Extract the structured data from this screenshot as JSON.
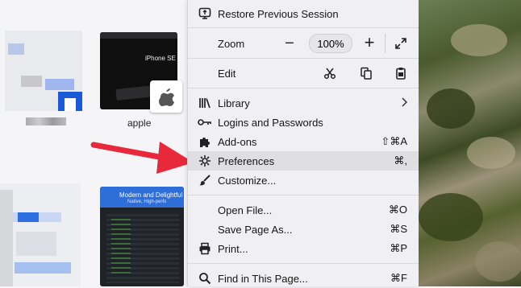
{
  "tiles": [
    {
      "label": ""
    },
    {
      "label": "apple",
      "thumb_title": "iPhone SE"
    },
    {
      "label": ""
    },
    {
      "label": "",
      "thumb_title": "Modern and Delightful",
      "thumb_sub": "Native, High-perfo"
    }
  ],
  "menu": {
    "restore": "Restore Previous Session",
    "zoom": "Zoom",
    "zoom_minus": "−",
    "zoom_value": "100%",
    "zoom_plus": "+",
    "edit": "Edit",
    "library": "Library",
    "logins": "Logins and Passwords",
    "addons": "Add-ons",
    "addons_shortcut": "⇧⌘A",
    "preferences": "Preferences",
    "preferences_shortcut": "⌘,",
    "customize": "Customize...",
    "open_file": "Open File...",
    "open_file_shortcut": "⌘O",
    "save_page": "Save Page As...",
    "save_page_shortcut": "⌘S",
    "print": "Print...",
    "print_shortcut": "⌘P",
    "find": "Find in This Page...",
    "find_shortcut": "⌘F"
  },
  "colors": {
    "arrow": "#e8293b",
    "highlight": "#dfdfe2"
  }
}
